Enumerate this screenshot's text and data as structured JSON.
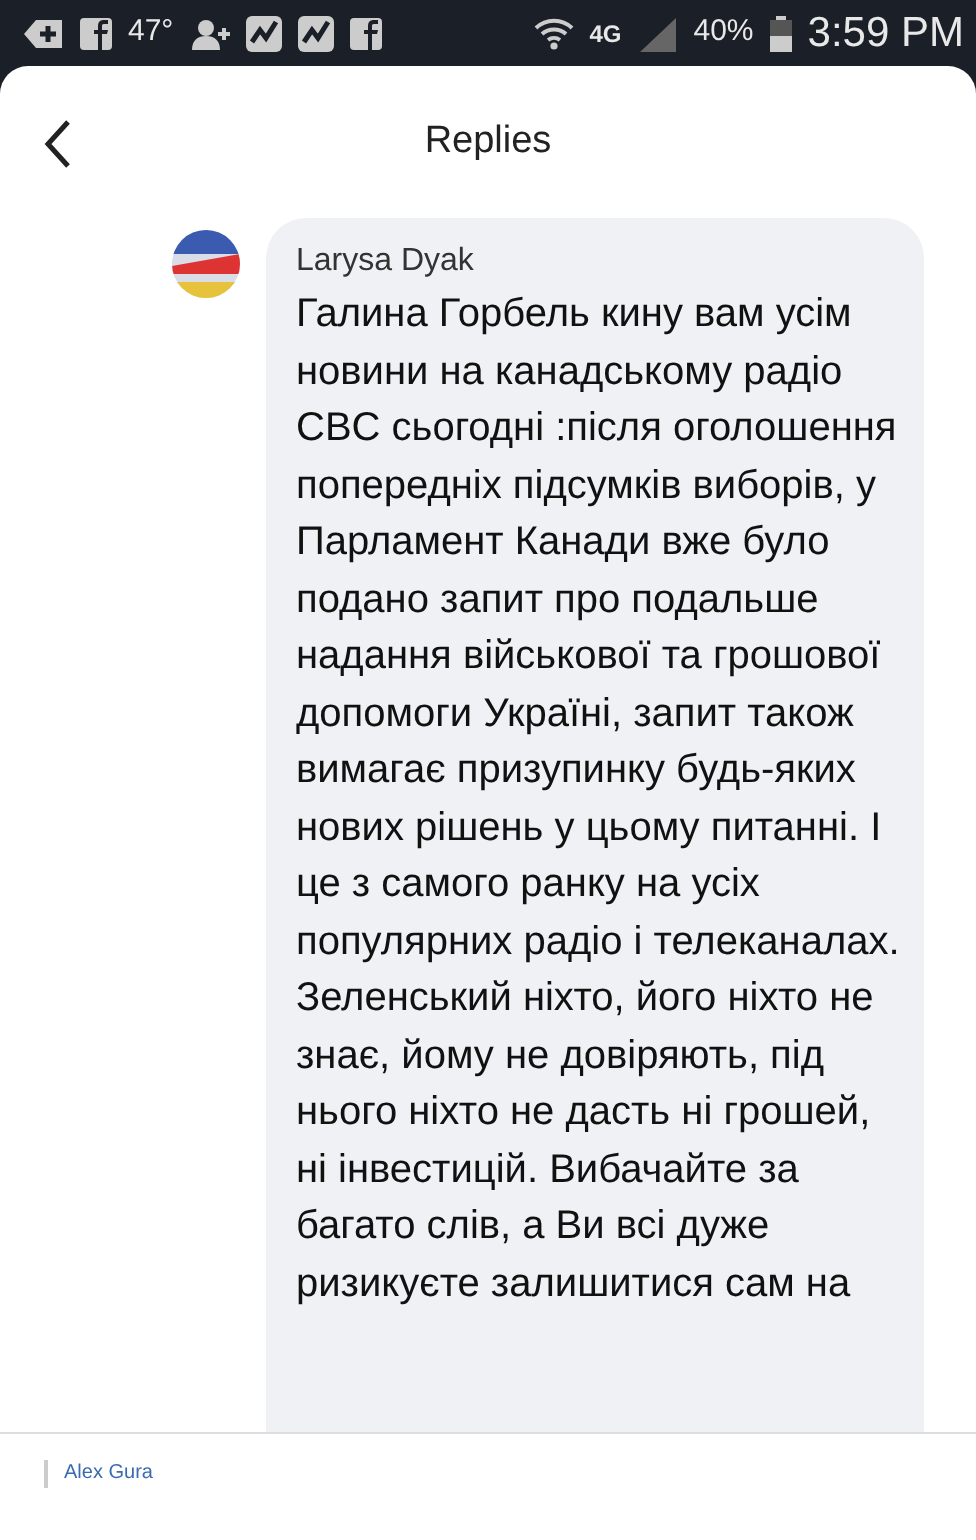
{
  "status_bar": {
    "temperature": "47°",
    "network": "4G",
    "battery": "40%",
    "time": "3:59 PM"
  },
  "header": {
    "title": "Replies"
  },
  "comment": {
    "author": "Larysa Dyak",
    "text": "Галина Горбель кину вам усім новини на канадському радіо CBC сьогодні :після оголошення попередніх підсумків виборів, у Парламент Канади вже було подано запит про подальше надання військової та грошової допомоги Україні, запит також вимагає призупинку будь-яких нових рішень у цьому питанні. І це з самого ранку на усіх популярних радіо і телеканалах. Зеленський ніхто, його ніхто не знає, йому не довіряють, під нього ніхто не дасть ні грошей, ні інвестицій. Вибачайте за багато слів, а Ви всі дуже ризикуєте залишитися сам на"
  },
  "next_reply": {
    "author": "Alex Gura"
  }
}
